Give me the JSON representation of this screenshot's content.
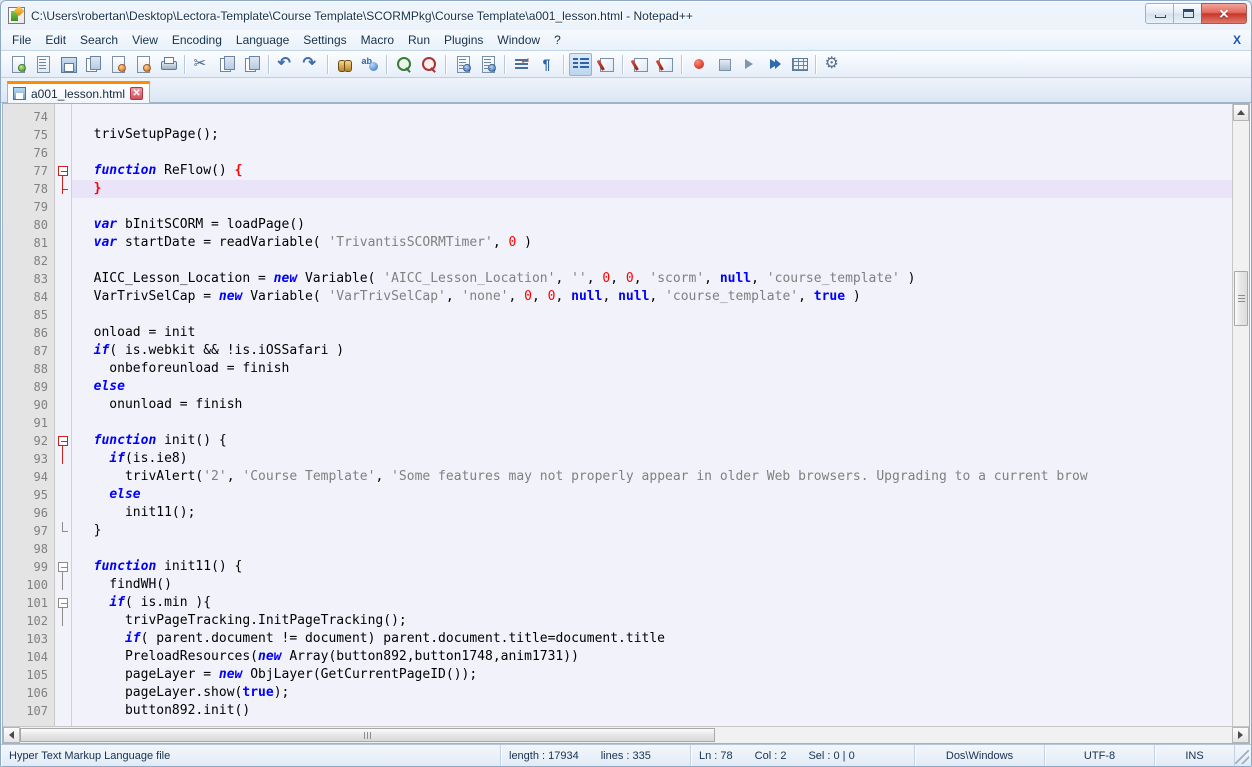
{
  "window": {
    "title": "C:\\Users\\robertan\\Desktop\\Lectora-Template\\Course Template\\SCORMPkg\\Course Template\\a001_lesson.html - Notepad++",
    "app_icon": "notepad-plus-plus-icon",
    "controls": {
      "minimize": "minimize-button",
      "maximize": "maximize-button",
      "close": "✕"
    }
  },
  "menubar": {
    "items": [
      {
        "label": "File"
      },
      {
        "label": "Edit"
      },
      {
        "label": "Search"
      },
      {
        "label": "View"
      },
      {
        "label": "Encoding"
      },
      {
        "label": "Language"
      },
      {
        "label": "Settings"
      },
      {
        "label": "Macro"
      },
      {
        "label": "Run"
      },
      {
        "label": "Plugins"
      },
      {
        "label": "Window"
      },
      {
        "label": "?"
      }
    ],
    "close_document": "X"
  },
  "toolbar": {
    "buttons": [
      {
        "name": "new-file-icon",
        "kind": "page-green"
      },
      {
        "name": "open-file-icon",
        "kind": "page-lined"
      },
      {
        "name": "save-icon",
        "kind": "floppy"
      },
      {
        "name": "save-all-icon",
        "kind": "copy"
      },
      {
        "name": "close-file-icon",
        "kind": "page-orange"
      },
      {
        "name": "close-all-files-icon",
        "kind": "page-orange2"
      },
      {
        "name": "print-icon",
        "kind": "printer"
      },
      {
        "name": "sep1",
        "kind": "sep"
      },
      {
        "name": "cut-icon",
        "kind": "scissors"
      },
      {
        "name": "copy-icon",
        "kind": "copy"
      },
      {
        "name": "paste-icon",
        "kind": "copy"
      },
      {
        "name": "sep2",
        "kind": "sep"
      },
      {
        "name": "undo-icon",
        "kind": "undo"
      },
      {
        "name": "redo-icon",
        "kind": "redo"
      },
      {
        "name": "sep3",
        "kind": "sep"
      },
      {
        "name": "find-icon",
        "kind": "binocular"
      },
      {
        "name": "replace-icon",
        "kind": "ab"
      },
      {
        "name": "sep4",
        "kind": "sep"
      },
      {
        "name": "zoom-in-icon",
        "kind": "zoomin"
      },
      {
        "name": "zoom-out-icon",
        "kind": "zoomout"
      },
      {
        "name": "sep5",
        "kind": "sep"
      },
      {
        "name": "sync-vertical-scroll-icon",
        "kind": "page-blue"
      },
      {
        "name": "sync-horizontal-scroll-icon",
        "kind": "page-blue2"
      },
      {
        "name": "sep6",
        "kind": "sep"
      },
      {
        "name": "word-wrap-icon",
        "kind": "wrap"
      },
      {
        "name": "show-all-chars-icon",
        "kind": "pilcrow"
      },
      {
        "name": "sep7",
        "kind": "sep"
      },
      {
        "name": "indent-guide-icon",
        "kind": "indent",
        "active": true
      },
      {
        "name": "show-whitespace-icon",
        "kind": "pencil"
      },
      {
        "name": "sep8",
        "kind": "sep"
      },
      {
        "name": "user-define-dialog-icon",
        "kind": "pencil2"
      },
      {
        "name": "doc-map-icon",
        "kind": "pencil3"
      },
      {
        "name": "sep9",
        "kind": "sep"
      },
      {
        "name": "record-macro-icon",
        "kind": "rec"
      },
      {
        "name": "stop-macro-icon",
        "kind": "stop"
      },
      {
        "name": "play-macro-icon",
        "kind": "play"
      },
      {
        "name": "run-macro-multiple-icon",
        "kind": "playfast"
      },
      {
        "name": "save-macro-icon",
        "kind": "grid"
      },
      {
        "name": "sep10",
        "kind": "sep"
      },
      {
        "name": "run-icon",
        "kind": "gear"
      }
    ]
  },
  "tabs": [
    {
      "label": "a001_lesson.html",
      "close": "✕",
      "active": true
    }
  ],
  "editor": {
    "current_line": 78,
    "first_visible_line": 74,
    "lines": [
      {
        "n": 74,
        "tokens": []
      },
      {
        "n": 75,
        "tokens": [
          {
            "t": "  trivSetupPage();",
            "c": "plain"
          }
        ]
      },
      {
        "n": 76,
        "tokens": []
      },
      {
        "n": 77,
        "fold": "open",
        "tokens": [
          {
            "t": "  ",
            "c": "plain"
          },
          {
            "t": "function",
            "c": "kw"
          },
          {
            "t": " ReFlow() ",
            "c": "plain"
          },
          {
            "t": "{",
            "c": "brace"
          }
        ]
      },
      {
        "n": 78,
        "fold": "end",
        "current": true,
        "tokens": [
          {
            "t": "  ",
            "c": "plain"
          },
          {
            "t": "}",
            "c": "brace"
          }
        ]
      },
      {
        "n": 79,
        "tokens": []
      },
      {
        "n": 80,
        "tokens": [
          {
            "t": "  ",
            "c": "plain"
          },
          {
            "t": "var",
            "c": "kw"
          },
          {
            "t": " bInitSCORM = loadPage()",
            "c": "plain"
          }
        ]
      },
      {
        "n": 81,
        "tokens": [
          {
            "t": "  ",
            "c": "plain"
          },
          {
            "t": "var",
            "c": "kw"
          },
          {
            "t": " startDate = readVariable( ",
            "c": "plain"
          },
          {
            "t": "'TrivantisSCORMTimer'",
            "c": "str"
          },
          {
            "t": ", ",
            "c": "plain"
          },
          {
            "t": "0",
            "c": "num"
          },
          {
            "t": " )",
            "c": "plain"
          }
        ]
      },
      {
        "n": 82,
        "tokens": []
      },
      {
        "n": 83,
        "tokens": [
          {
            "t": "  AICC_Lesson_Location = ",
            "c": "plain"
          },
          {
            "t": "new",
            "c": "kw"
          },
          {
            "t": " Variable( ",
            "c": "plain"
          },
          {
            "t": "'AICC_Lesson_Location'",
            "c": "str"
          },
          {
            "t": ", ",
            "c": "plain"
          },
          {
            "t": "''",
            "c": "str"
          },
          {
            "t": ", ",
            "c": "plain"
          },
          {
            "t": "0",
            "c": "num"
          },
          {
            "t": ", ",
            "c": "plain"
          },
          {
            "t": "0",
            "c": "num"
          },
          {
            "t": ", ",
            "c": "plain"
          },
          {
            "t": "'scorm'",
            "c": "str"
          },
          {
            "t": ", ",
            "c": "plain"
          },
          {
            "t": "null",
            "c": "kw2"
          },
          {
            "t": ", ",
            "c": "plain"
          },
          {
            "t": "'course_template'",
            "c": "str"
          },
          {
            "t": " )",
            "c": "plain"
          }
        ]
      },
      {
        "n": 84,
        "tokens": [
          {
            "t": "  VarTrivSelCap = ",
            "c": "plain"
          },
          {
            "t": "new",
            "c": "kw"
          },
          {
            "t": " Variable( ",
            "c": "plain"
          },
          {
            "t": "'VarTrivSelCap'",
            "c": "str"
          },
          {
            "t": ", ",
            "c": "plain"
          },
          {
            "t": "'none'",
            "c": "str"
          },
          {
            "t": ", ",
            "c": "plain"
          },
          {
            "t": "0",
            "c": "num"
          },
          {
            "t": ", ",
            "c": "plain"
          },
          {
            "t": "0",
            "c": "num"
          },
          {
            "t": ", ",
            "c": "plain"
          },
          {
            "t": "null",
            "c": "kw2"
          },
          {
            "t": ", ",
            "c": "plain"
          },
          {
            "t": "null",
            "c": "kw2"
          },
          {
            "t": ", ",
            "c": "plain"
          },
          {
            "t": "'course_template'",
            "c": "str"
          },
          {
            "t": ", ",
            "c": "plain"
          },
          {
            "t": "true",
            "c": "kw2"
          },
          {
            "t": " )",
            "c": "plain"
          }
        ]
      },
      {
        "n": 85,
        "tokens": []
      },
      {
        "n": 86,
        "tokens": [
          {
            "t": "  onload = init",
            "c": "plain"
          }
        ]
      },
      {
        "n": 87,
        "tokens": [
          {
            "t": "  ",
            "c": "plain"
          },
          {
            "t": "if",
            "c": "kw"
          },
          {
            "t": "( is.webkit && !is.iOSSafari )",
            "c": "plain"
          }
        ]
      },
      {
        "n": 88,
        "tokens": [
          {
            "t": "    onbeforeunload = finish",
            "c": "plain"
          }
        ]
      },
      {
        "n": 89,
        "tokens": [
          {
            "t": "  ",
            "c": "plain"
          },
          {
            "t": "else",
            "c": "kw"
          }
        ]
      },
      {
        "n": 90,
        "tokens": [
          {
            "t": "    onunload = finish",
            "c": "plain"
          }
        ]
      },
      {
        "n": 91,
        "tokens": []
      },
      {
        "n": 92,
        "fold": "open",
        "tokens": [
          {
            "t": "  ",
            "c": "plain"
          },
          {
            "t": "function",
            "c": "kw"
          },
          {
            "t": " init() {",
            "c": "plain"
          }
        ]
      },
      {
        "n": 93,
        "tokens": [
          {
            "t": "    ",
            "c": "plain"
          },
          {
            "t": "if",
            "c": "kw"
          },
          {
            "t": "(is.ie8)",
            "c": "plain"
          }
        ]
      },
      {
        "n": 94,
        "tokens": [
          {
            "t": "      trivAlert(",
            "c": "plain"
          },
          {
            "t": "'2'",
            "c": "str"
          },
          {
            "t": ", ",
            "c": "plain"
          },
          {
            "t": "'Course Template'",
            "c": "str"
          },
          {
            "t": ", ",
            "c": "plain"
          },
          {
            "t": "'Some features may not properly appear in older Web browsers. Upgrading to a current brow",
            "c": "str"
          }
        ]
      },
      {
        "n": 95,
        "tokens": [
          {
            "t": "    ",
            "c": "plain"
          },
          {
            "t": "else",
            "c": "kw"
          }
        ]
      },
      {
        "n": 96,
        "tokens": [
          {
            "t": "      init11();",
            "c": "plain"
          }
        ]
      },
      {
        "n": 97,
        "fold": "end-gray",
        "tokens": [
          {
            "t": "  }",
            "c": "plain"
          }
        ]
      },
      {
        "n": 98,
        "tokens": []
      },
      {
        "n": 99,
        "fold": "open-gray",
        "tokens": [
          {
            "t": "  ",
            "c": "plain"
          },
          {
            "t": "function",
            "c": "kw"
          },
          {
            "t": " init11() {",
            "c": "plain"
          }
        ]
      },
      {
        "n": 100,
        "tokens": [
          {
            "t": "    findWH()",
            "c": "plain"
          }
        ]
      },
      {
        "n": 101,
        "fold": "open-gray",
        "tokens": [
          {
            "t": "    ",
            "c": "plain"
          },
          {
            "t": "if",
            "c": "kw"
          },
          {
            "t": "( is.min ){",
            "c": "plain"
          }
        ]
      },
      {
        "n": 102,
        "tokens": [
          {
            "t": "      trivPageTracking.InitPageTracking();",
            "c": "plain"
          }
        ]
      },
      {
        "n": 103,
        "tokens": [
          {
            "t": "      ",
            "c": "plain"
          },
          {
            "t": "if",
            "c": "kw"
          },
          {
            "t": "( parent.document != document) parent.document.title=document.title",
            "c": "plain"
          }
        ]
      },
      {
        "n": 104,
        "tokens": [
          {
            "t": "      PreloadResources(",
            "c": "plain"
          },
          {
            "t": "new",
            "c": "kw"
          },
          {
            "t": " Array(button892,button1748,anim1731))",
            "c": "plain"
          }
        ]
      },
      {
        "n": 105,
        "tokens": [
          {
            "t": "      pageLayer = ",
            "c": "plain"
          },
          {
            "t": "new",
            "c": "kw"
          },
          {
            "t": " ObjLayer(GetCurrentPageID());",
            "c": "plain"
          }
        ]
      },
      {
        "n": 106,
        "tokens": [
          {
            "t": "      pageLayer.show(",
            "c": "plain"
          },
          {
            "t": "true",
            "c": "kw2"
          },
          {
            "t": ");",
            "c": "plain"
          }
        ]
      },
      {
        "n": 107,
        "tokens": [
          {
            "t": "      button892.init()",
            "c": "plain"
          }
        ]
      }
    ]
  },
  "statusbar": {
    "file_type": "Hyper Text Markup Language file",
    "length_label": "length : 17934",
    "lines_label": "lines : 335",
    "ln": "Ln : 78",
    "col": "Col : 2",
    "sel": "Sel : 0 | 0",
    "eol": "Dos\\Windows",
    "encoding": "UTF-8",
    "insert_mode": "INS"
  },
  "colors": {
    "accent_orange": "#ff8c00",
    "keyword_blue": "#0000ff",
    "string_gray": "#808080",
    "number_red": "#ff0000",
    "current_line": "#e9e4f7",
    "editor_bg": "#f2f2fa",
    "gutter_bg": "#e4e4e4"
  }
}
